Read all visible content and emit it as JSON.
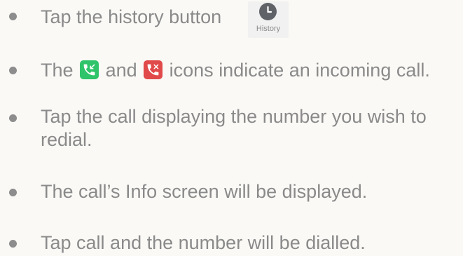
{
  "items": [
    {
      "text": "Tap the history button"
    },
    {
      "text_before": "The",
      "text_middle": "and",
      "text_after": "icons indicate an incoming call."
    },
    {
      "line1": "Tap the call displaying the number you wish to",
      "line2": "redial."
    },
    {
      "text": "The call’s Info screen will be displayed."
    },
    {
      "text": "Tap call and the number will be dialled."
    }
  ],
  "history_button": {
    "label": "History",
    "icon": "clock-icon"
  },
  "icons": {
    "incoming_green": {
      "name": "phone-incoming-green-icon",
      "color": "#2fc46a"
    },
    "incoming_red": {
      "name": "phone-incoming-red-icon",
      "color": "#e14a4a"
    }
  }
}
